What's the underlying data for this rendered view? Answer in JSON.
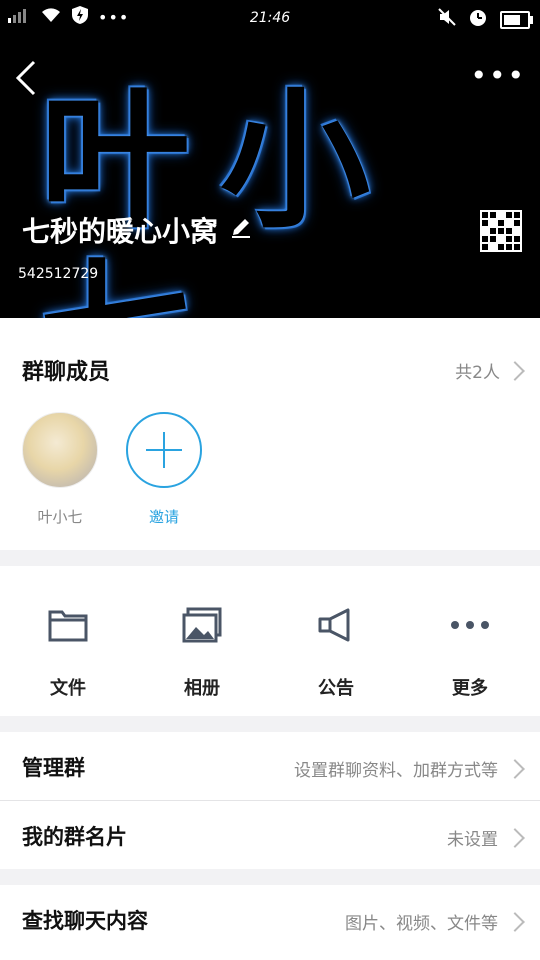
{
  "status": {
    "time": "21:46"
  },
  "group": {
    "art_text": "叶小七",
    "name": "七秒的暖心小窝",
    "id": "542512729"
  },
  "members": {
    "title": "群聊成员",
    "count": "共2人",
    "list": [
      {
        "name": "叶小七"
      }
    ],
    "invite_label": "邀请"
  },
  "tools": [
    {
      "label": "文件",
      "icon": "folder-icon"
    },
    {
      "label": "相册",
      "icon": "album-icon"
    },
    {
      "label": "公告",
      "icon": "megaphone-icon"
    },
    {
      "label": "更多",
      "icon": "more-icon"
    }
  ],
  "rows": {
    "manage": {
      "title": "管理群",
      "value": "设置群聊资料、加群方式等"
    },
    "card": {
      "title": "我的群名片",
      "value": "未设置"
    },
    "search": {
      "title": "查找聊天内容",
      "value": "图片、视频、文件等"
    }
  },
  "colors": {
    "accent": "#2aa3e0",
    "glow": "#2d7fe0"
  }
}
